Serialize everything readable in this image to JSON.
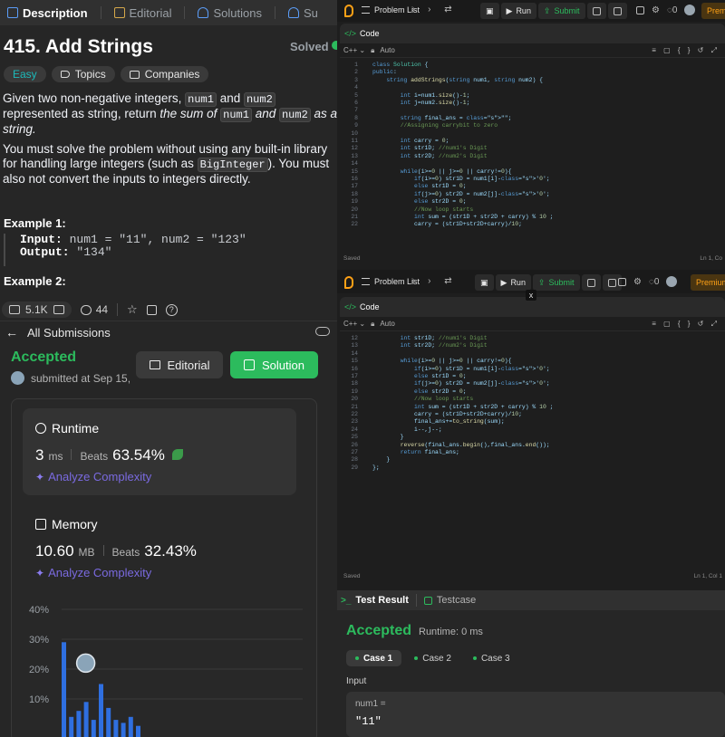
{
  "desc": {
    "tabs": [
      "Description",
      "Editorial",
      "Solutions",
      "Su"
    ],
    "title": "415. Add Strings",
    "solved": "Solved",
    "chips": [
      "Easy",
      "Topics",
      "Companies"
    ],
    "para1": {
      "a": "Given two non-negative integers, ",
      "c1": "num1",
      "b": " and ",
      "c2": "num2",
      "d": " represented as string, return ",
      "e": "the sum of ",
      "c3": "num1",
      "f": " and ",
      "c4": "num2",
      "g": " as a string."
    },
    "para2": {
      "a": "You must solve the problem without using any built-in library for handling large integers (such as ",
      "c1": "BigInteger",
      "b": "). You must also not convert the inputs to integers directly."
    },
    "example1_title": "Example 1:",
    "example1_input_label": "Input:",
    "example1_input": "num1 = \"11\", num2 = \"123\"",
    "example1_output_label": "Output:",
    "example1_output": "\"134\"",
    "example2_title": "Example 2:",
    "likes": "5.1K",
    "comments": "44"
  },
  "submission": {
    "back_label": "All Submissions",
    "status": "Accepted",
    "submitted": "submitted at Sep 15,",
    "editorial_btn": "Editorial",
    "solution_btn": "Solution",
    "runtime": {
      "title": "Runtime",
      "value": "3",
      "unit": "ms",
      "beats_label": "Beats",
      "beats": "63.54%",
      "analyze": "Analyze Complexity"
    },
    "memory": {
      "title": "Memory",
      "value": "10.60",
      "unit": "MB",
      "beats_label": "Beats",
      "beats": "32.43%",
      "analyze": "Analyze Complexity"
    }
  },
  "chart_data": {
    "type": "bar",
    "yticks": [
      "40%",
      "30%",
      "20%",
      "10%"
    ],
    "ylim": [
      0,
      40
    ],
    "values": [
      29,
      4,
      6,
      9,
      3,
      15,
      7,
      3,
      2,
      4,
      1
    ]
  },
  "ide": {
    "problem_list": "Problem List",
    "run": "Run",
    "submit": "Submit",
    "notif_count": "0",
    "premium": "Premium",
    "premium_cut": "Premu",
    "code_tab": "Code",
    "lang": "C++",
    "auto": "Auto",
    "saved": "Saved",
    "cursor_top": "Ln 1, Co",
    "cursor_bottom": "Ln 1, Col 1",
    "close": "x"
  },
  "code_top": [
    {
      "n": "1",
      "t": "class Solution {"
    },
    {
      "n": "2",
      "t": "public:"
    },
    {
      "n": "3",
      "t": "    string addStrings(string num1, string num2) {"
    },
    {
      "n": "4",
      "t": ""
    },
    {
      "n": "5",
      "t": "        int i=num1.size()-1;"
    },
    {
      "n": "6",
      "t": "        int j=num2.size()-1;"
    },
    {
      "n": "7",
      "t": ""
    },
    {
      "n": "8",
      "t": "        string final_ans = \"\";"
    },
    {
      "n": "9",
      "t": "        //Assigning carrybit to zero"
    },
    {
      "n": "10",
      "t": ""
    },
    {
      "n": "11",
      "t": "        int carry = 0;"
    },
    {
      "n": "12",
      "t": "        int str1D; //num1's Digit"
    },
    {
      "n": "13",
      "t": "        int str2D; //num2's Digit"
    },
    {
      "n": "14",
      "t": ""
    },
    {
      "n": "15",
      "t": "        while(i>=0 || j>=0 || carry!=0){"
    },
    {
      "n": "16",
      "t": "            if(i>=0) str1D = num1[i]-'0';"
    },
    {
      "n": "17",
      "t": "            else str1D = 0;"
    },
    {
      "n": "18",
      "t": "            if(j>=0) str2D = num2[j]-'0';"
    },
    {
      "n": "19",
      "t": "            else str2D = 0;"
    },
    {
      "n": "20",
      "t": "            //Now loop starts"
    },
    {
      "n": "21",
      "t": "            int sum = (str1D + str2D + carry) % 10 ;"
    },
    {
      "n": "22",
      "t": "            carry = (str1D+str2D+carry)/10;"
    }
  ],
  "code_bottom": [
    {
      "n": "12",
      "t": "        int str1D; //num1's Digit"
    },
    {
      "n": "13",
      "t": "        int str2D; //num2's Digit"
    },
    {
      "n": "14",
      "t": ""
    },
    {
      "n": "15",
      "t": "        while(i>=0 || j>=0 || carry!=0){"
    },
    {
      "n": "16",
      "t": "            if(i>=0) str1D = num1[i]-'0';"
    },
    {
      "n": "17",
      "t": "            else str1D = 0;"
    },
    {
      "n": "18",
      "t": "            if(j>=0) str2D = num2[j]-'0';"
    },
    {
      "n": "19",
      "t": "            else str2D = 0;"
    },
    {
      "n": "20",
      "t": "            //Now loop starts"
    },
    {
      "n": "21",
      "t": "            int sum = (str1D + str2D + carry) % 10 ;"
    },
    {
      "n": "22",
      "t": "            carry = (str1D+str2D+carry)/10;"
    },
    {
      "n": "23",
      "t": "            final_ans+=to_string(sum);"
    },
    {
      "n": "24",
      "t": "            i--,j--;"
    },
    {
      "n": "25",
      "t": "        }"
    },
    {
      "n": "26",
      "t": "        reverse(final_ans.begin(),final_ans.end());"
    },
    {
      "n": "27",
      "t": "        return final_ans;"
    },
    {
      "n": "28",
      "t": "    }"
    },
    {
      "n": "29",
      "t": "};"
    }
  ],
  "test": {
    "tab_result": "Test Result",
    "tab_case": "Testcase",
    "status": "Accepted",
    "runtime": "Runtime: 0 ms",
    "cases": [
      "Case 1",
      "Case 2",
      "Case 3"
    ],
    "input_label": "Input",
    "input_name": "num1 =",
    "input_value": "\"11\""
  },
  "colors": {
    "accent_green": "#2cbb5d",
    "brand_orange": "#ffa116",
    "bar_blue": "#2f6fe0",
    "purple": "#7a6ae0"
  }
}
